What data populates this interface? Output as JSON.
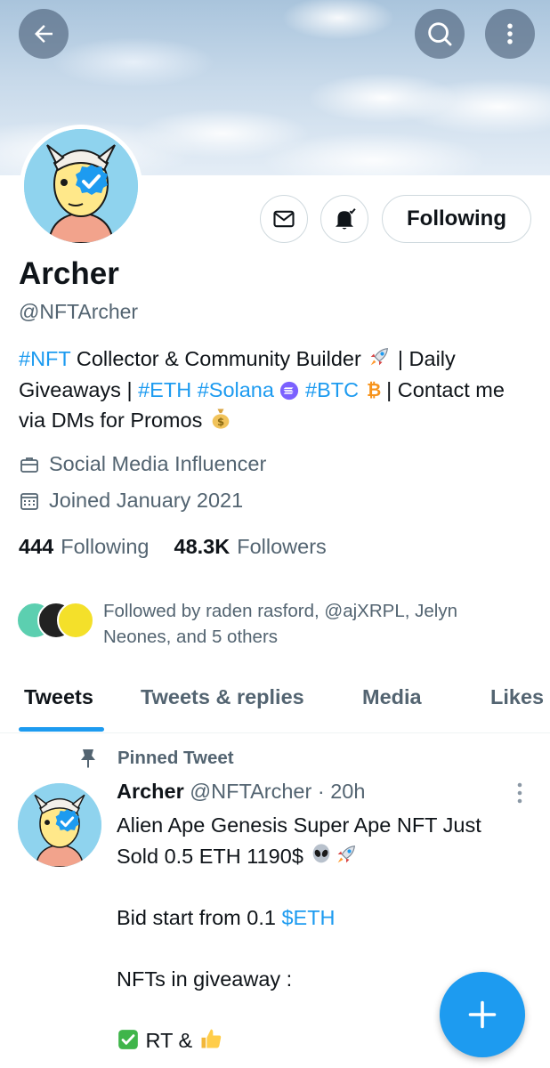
{
  "profile": {
    "name": "Archer",
    "handle": "@NFTArcher",
    "bio": {
      "tag_nft": "#NFT",
      "text1": " Collector & Community Builder ",
      "text2": " | Daily Giveaways | ",
      "tag_eth": "#ETH",
      "space1": " ",
      "tag_solana": "#Solana",
      "space2": "  ",
      "tag_btc": "#BTC",
      "text3": "  | Contact me via DMs for Promos "
    },
    "category": "Social Media Influencer",
    "joined": "Joined January 2021",
    "following_count": "444",
    "following_label": "Following",
    "followers_count": "48.3K",
    "followers_label": "Followers",
    "followed_by": "Followed by raden rasford, @ajXRPL, Jelyn Neones, and 5 others"
  },
  "actions": {
    "following_button": "Following"
  },
  "tabs": [
    {
      "label": "Tweets",
      "active": true
    },
    {
      "label": "Tweets & replies"
    },
    {
      "label": "Media"
    },
    {
      "label": "Likes"
    }
  ],
  "tweet": {
    "pinned_label": "Pinned Tweet",
    "author_name": "Archer",
    "author_handle": "@NFTArcher",
    "time": " · 20h",
    "line1": "Alien Ape Genesis Super Ape NFT Just Sold 0.5 ETH 1190$ ",
    "line2_prefix": "Bid start from 0.1 ",
    "line2_cashtag": "$ETH",
    "line3": "NFTs in giveaway :",
    "line4": " RT & "
  },
  "colors": {
    "accent": "#1d9bf0",
    "text_primary": "#0f1419",
    "text_secondary": "#536471",
    "border": "#cfd9de"
  },
  "icons": [
    "back-arrow-icon",
    "search-icon",
    "more-vertical-icon",
    "mail-icon",
    "bell-icon",
    "briefcase-icon",
    "calendar-icon",
    "pin-icon",
    "plus-icon"
  ]
}
